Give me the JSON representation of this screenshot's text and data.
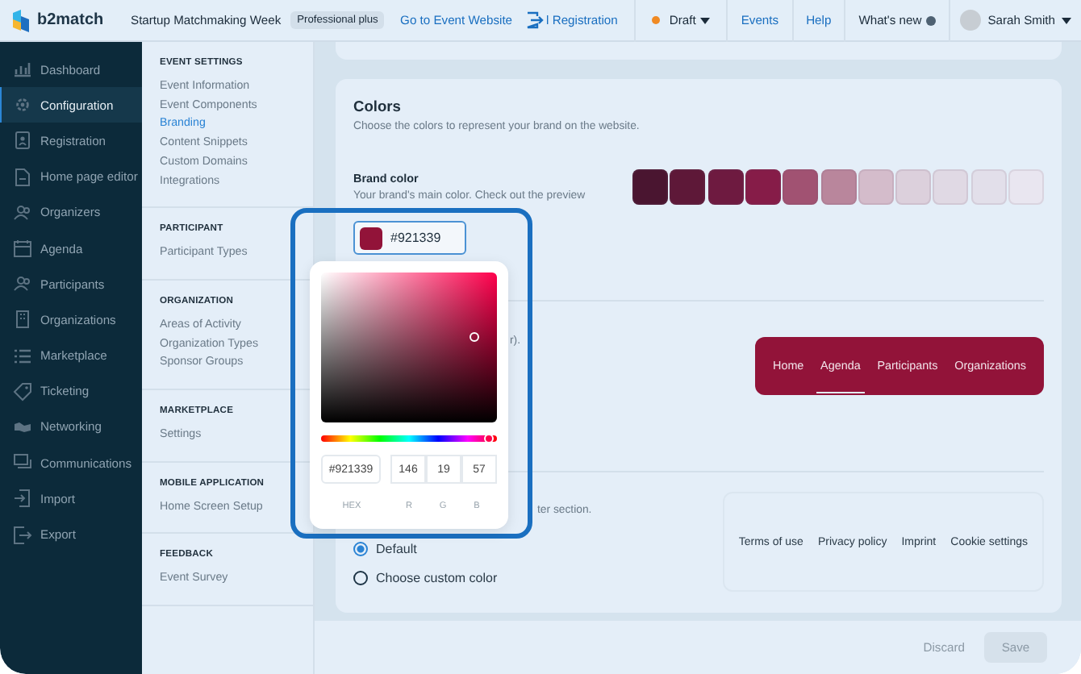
{
  "topbar": {
    "logo": "b2match",
    "event_name": "Startup Matchmaking Week",
    "plan_badge": "Professional plus",
    "links": [
      {
        "label": "Go to Event Website",
        "kind": "text"
      },
      {
        "label": "l Registration",
        "kind": "icon"
      }
    ],
    "status": {
      "label": "Draft",
      "color": "#f08a24"
    },
    "menu": [
      "Events",
      "Help"
    ],
    "whats_new": "What's new",
    "user": "Sarah Smith"
  },
  "sidebar": {
    "items": [
      {
        "label": "Dashboard",
        "selected": false
      },
      {
        "label": "Configuration",
        "selected": true
      },
      {
        "label": "Registration",
        "selected": false
      },
      {
        "label": "Home page editor",
        "selected": false
      },
      {
        "label": "Organizers",
        "selected": false
      },
      {
        "label": "Agenda",
        "selected": false
      },
      {
        "label": "Participants",
        "selected": false
      },
      {
        "label": "Organizations",
        "selected": false
      },
      {
        "label": "Marketplace",
        "selected": false
      },
      {
        "label": "Ticketing",
        "selected": false
      },
      {
        "label": "Networking",
        "selected": false
      },
      {
        "label": "Communications",
        "selected": false
      },
      {
        "label": "Import",
        "selected": false
      },
      {
        "label": "Export",
        "selected": false
      }
    ]
  },
  "subnav": {
    "sections": [
      {
        "title": "EVENT SETTINGS",
        "items": [
          {
            "label": "Event Information",
            "selected": false
          },
          {
            "label": "Event Components",
            "selected": false
          },
          {
            "label": "Branding",
            "selected": true
          },
          {
            "label": "Content Snippets",
            "selected": false
          },
          {
            "label": "Custom Domains",
            "selected": false
          },
          {
            "label": "Integrations",
            "selected": false
          }
        ]
      },
      {
        "title": "PARTICIPANT",
        "items": [
          {
            "label": "Participant Types",
            "selected": false
          }
        ]
      },
      {
        "title": "ORGANIZATION",
        "items": [
          {
            "label": "Areas of Activity",
            "selected": false
          },
          {
            "label": "Organization Types",
            "selected": false
          },
          {
            "label": "Sponsor Groups",
            "selected": false
          }
        ]
      },
      {
        "title": "MARKETPLACE",
        "items": [
          {
            "label": "Settings",
            "selected": false
          }
        ]
      },
      {
        "title": "MOBILE APPLICATION",
        "items": [
          {
            "label": "Home Screen Setup",
            "selected": false
          }
        ]
      },
      {
        "title": "FEEDBACK",
        "items": [
          {
            "label": "Event Survey",
            "selected": false
          }
        ]
      }
    ]
  },
  "colors": {
    "title": "Colors",
    "subtitle": "Choose the colors to represent your brand on the website.",
    "brand_color": {
      "label": "Brand color",
      "description": "Your brand's main color. Check out the preview",
      "value": "#921339",
      "palette": [
        {
          "color": "#4a1530"
        },
        {
          "color": "#5e1838"
        },
        {
          "color": "#6e1a40"
        },
        {
          "color": "#861c48"
        },
        {
          "color": "#a15272"
        },
        {
          "color": "#b9869c"
        },
        {
          "color": "#d4bccb"
        },
        {
          "color": "#dcd0dc"
        },
        {
          "color": "#e0d9e4"
        },
        {
          "color": "#e2dfea"
        },
        {
          "color": "#e9e6f0"
        }
      ]
    },
    "navigation": {
      "text_fragment": "r).",
      "preview_items": [
        {
          "label": "Home",
          "selected": false
        },
        {
          "label": "Agenda",
          "selected": true
        },
        {
          "label": "Participants",
          "selected": false
        },
        {
          "label": "Organizations",
          "selected": false
        }
      ]
    },
    "footer": {
      "text_fragment": "ter section.",
      "preview_links": [
        "Terms of use",
        "Privacy policy",
        "Imprint",
        "Cookie settings"
      ],
      "options": [
        {
          "label": "Default",
          "selected": true
        },
        {
          "label": "Choose custom color",
          "selected": false
        }
      ]
    }
  },
  "picker": {
    "hex_text": "#921339",
    "hue_slider": {
      "level": 0.95
    },
    "r": "146",
    "g": "19",
    "b": "57",
    "labels": [
      "HEX",
      "R",
      "G",
      "B"
    ]
  },
  "actions": {
    "discard": "Discard",
    "save": {
      "label": "Save",
      "disabled": true
    }
  }
}
